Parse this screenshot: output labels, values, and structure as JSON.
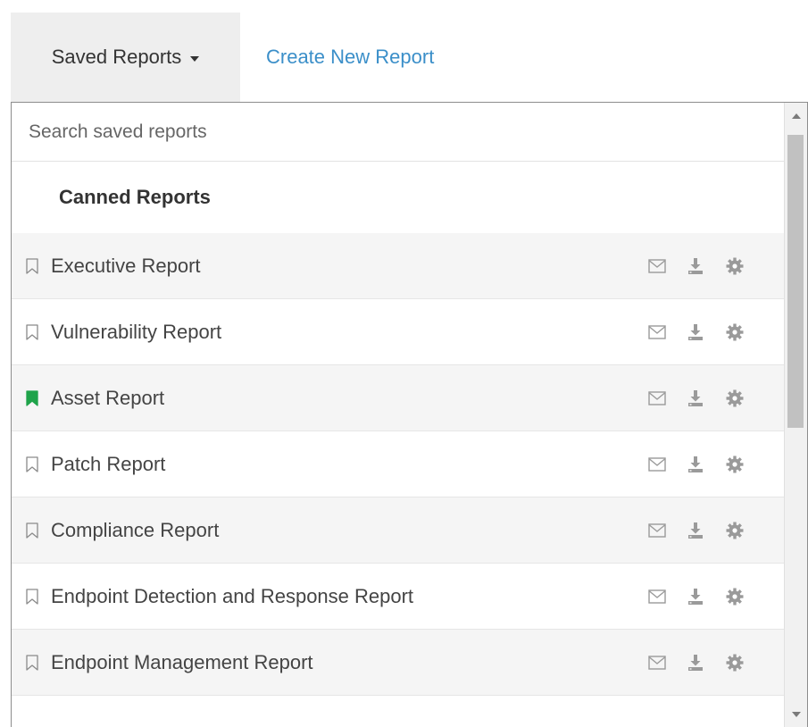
{
  "nav": {
    "saved_reports_label": "Saved Reports",
    "create_new_label": "Create New Report"
  },
  "search": {
    "placeholder": "Search saved reports",
    "value": ""
  },
  "canned": {
    "header": "Canned Reports",
    "items": [
      {
        "label": "Executive Report",
        "bookmarked": false
      },
      {
        "label": "Vulnerability Report",
        "bookmarked": false
      },
      {
        "label": "Asset Report",
        "bookmarked": true
      },
      {
        "label": "Patch Report",
        "bookmarked": false
      },
      {
        "label": "Compliance Report",
        "bookmarked": false
      },
      {
        "label": "Endpoint Detection and Response Report",
        "bookmarked": false
      },
      {
        "label": "Endpoint Management Report",
        "bookmarked": false
      }
    ]
  },
  "icons": {
    "bookmark_outline": "bookmark-outline-icon",
    "bookmark_filled": "bookmark-filled-icon",
    "email": "email-icon",
    "download": "download-icon",
    "settings": "gear-icon",
    "caret": "caret-down-icon"
  },
  "colors": {
    "link": "#3b8fc9",
    "bookmark_active": "#1fa34a",
    "icon_gray": "#9a9a9a",
    "tab_bg": "#eeeeee",
    "row_alt": "#f5f5f5"
  }
}
